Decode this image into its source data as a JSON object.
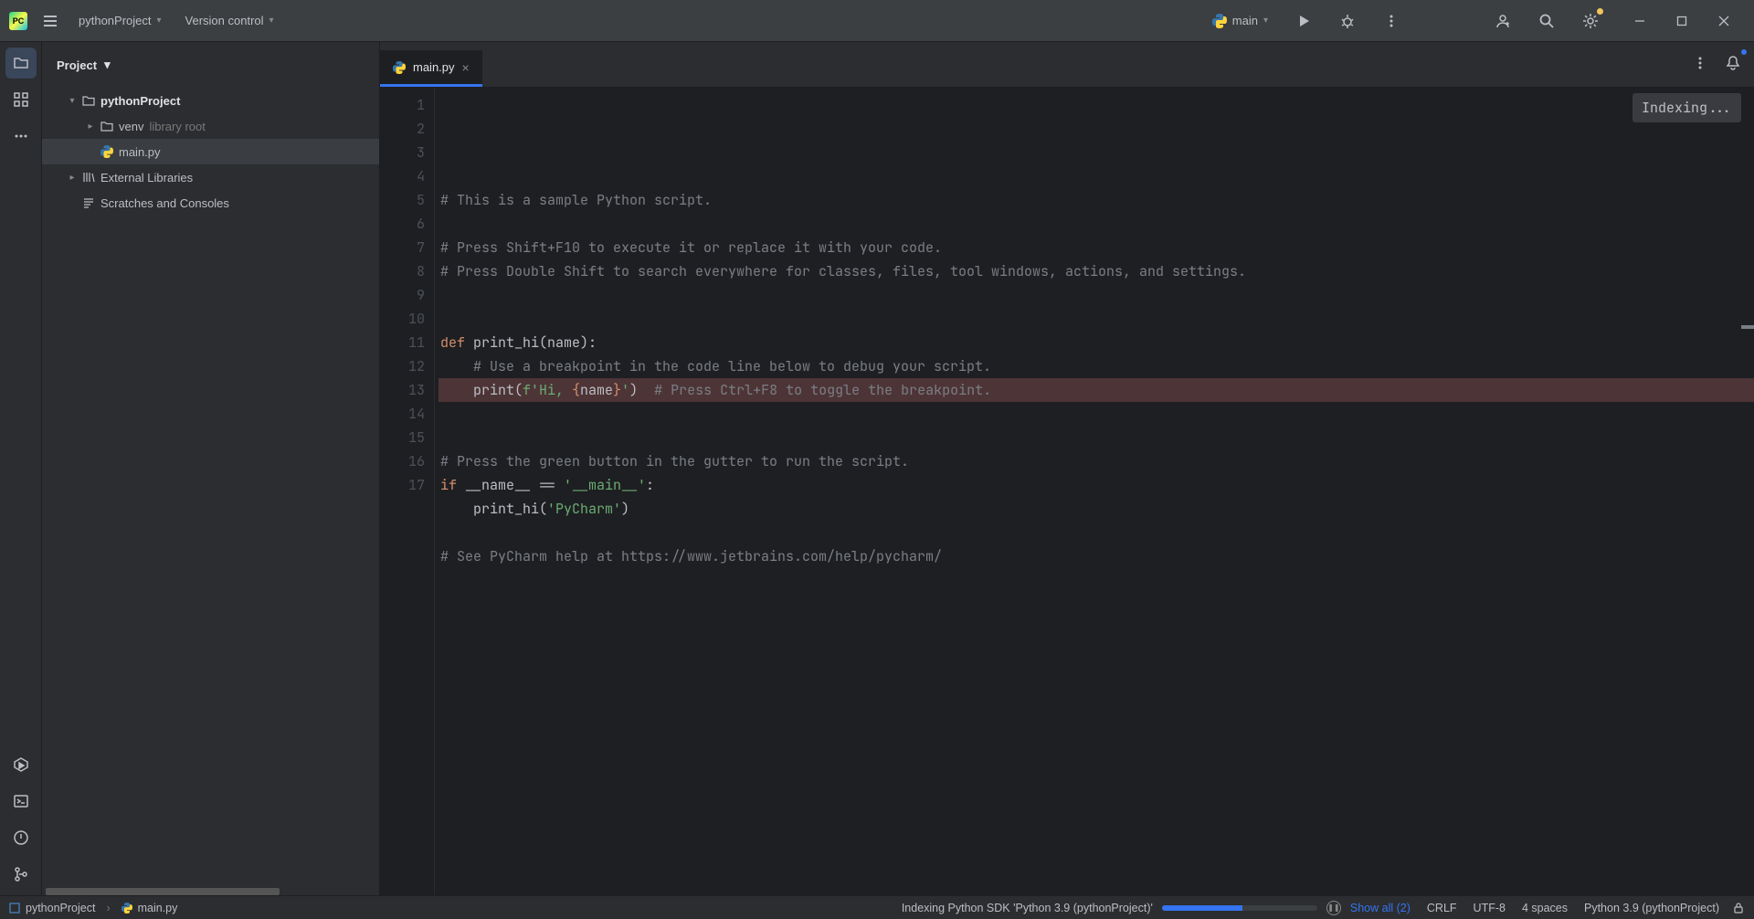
{
  "titlebar": {
    "project_name": "pythonProject",
    "vcs_label": "Version control",
    "run_config": "main"
  },
  "project_panel": {
    "title": "Project",
    "root": "pythonProject",
    "venv": "venv",
    "venv_hint": "library root",
    "main_file": "main.py",
    "external_libs": "External Libraries",
    "scratches": "Scratches and Consoles"
  },
  "tabs": {
    "active": "main.py"
  },
  "editor": {
    "indexing": "Indexing...",
    "lines": [
      {
        "n": 1,
        "html": "<span class='c-comment'># This is a sample Python script.</span>"
      },
      {
        "n": 2,
        "html": ""
      },
      {
        "n": 3,
        "html": "<span class='c-comment'># Press Shift+F10 to execute it or replace it with your code.</span>"
      },
      {
        "n": 4,
        "html": "<span class='c-comment'># Press Double Shift to search everywhere for classes, files, tool windows, actions, and settings.</span>"
      },
      {
        "n": 5,
        "html": ""
      },
      {
        "n": 6,
        "html": ""
      },
      {
        "n": 7,
        "html": "<span class='c-kw'>def</span> <span class='c-fn'>print_hi</span>(name):"
      },
      {
        "n": 8,
        "html": "    <span class='c-comment'># Use a breakpoint in the code line below to debug your script.</span>"
      },
      {
        "n": 9,
        "bp": true,
        "html": "    print(<span class='c-fstr'>f'Hi, </span><span class='c-brace'>{</span>name<span class='c-brace'>}</span><span class='c-fstr'>'</span>)  <span class='c-comment'># Press Ctrl+F8 to toggle the breakpoint.</span>"
      },
      {
        "n": 10,
        "html": ""
      },
      {
        "n": 11,
        "html": ""
      },
      {
        "n": 12,
        "html": "<span class='c-comment'># Press the green button in the gutter to run the script.</span>"
      },
      {
        "n": 13,
        "html": "<span class='c-kw'>if</span> __name__ == <span class='c-str'>'__main__'</span>:"
      },
      {
        "n": 14,
        "html": "    print_hi(<span class='c-str'>'PyCharm'</span>)"
      },
      {
        "n": 15,
        "html": ""
      },
      {
        "n": 16,
        "html": "<span class='c-comment'># See PyCharm help at https://www.jetbrains.com/help/pycharm/</span>"
      },
      {
        "n": 17,
        "html": ""
      }
    ]
  },
  "statusbar": {
    "crumb_project": "pythonProject",
    "crumb_file": "main.py",
    "indexing": "Indexing Python SDK 'Python 3.9 (pythonProject)'",
    "show_all": "Show all (2)",
    "line_ending": "CRLF",
    "encoding": "UTF-8",
    "indent": "4 spaces",
    "interpreter": "Python 3.9 (pythonProject)"
  }
}
